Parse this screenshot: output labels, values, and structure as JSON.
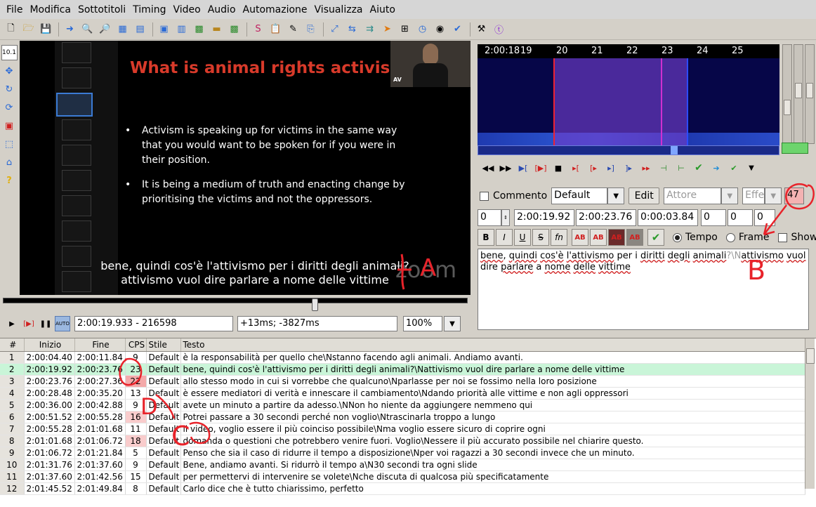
{
  "menu": [
    "File",
    "Modifica",
    "Sottotitoli",
    "Timing",
    "Video",
    "Audio",
    "Automazione",
    "Visualizza",
    "Aiuto"
  ],
  "video": {
    "slide_title": "What is animal rights activism",
    "bullet1": "Activism is speaking up for victims in the same way that you would want to be spoken for if you were in their position.",
    "bullet2": "It is being a medium of truth and enacting change by prioritising the victims and not the oppressors.",
    "subtitle_line1": "bene, quindi cos'è l'attivismo per i diritti degli animali?",
    "subtitle_line2": "attivismo vuol dire parlare a nome delle vittime",
    "cam_label": "AV",
    "watermark": "zoom",
    "time_field": "2:00:19.933 - 216598",
    "offset_field": "+13ms; -3827ms",
    "zoom_value": "100%",
    "seek_position_fraction": 0.68
  },
  "audio": {
    "ruler": [
      "2:00:18",
      "19",
      "20",
      "21",
      "22",
      "23",
      "24",
      "25"
    ]
  },
  "editor": {
    "comment_label": "Commento",
    "style_value": "Default",
    "edit_button": "Edit",
    "actor_placeholder": "Attore",
    "effect_placeholder": "Effe",
    "cps_value": "47",
    "layer": "0",
    "start": "2:00:19.92",
    "end": "2:00:23.76",
    "duration": "0:00:03.84",
    "margin_l": "0",
    "margin_r": "0",
    "margin_v": "0",
    "fmt_bold": "B",
    "fmt_italic": "I",
    "fmt_underline": "U",
    "fmt_strike": "S",
    "fmt_fn": "fn",
    "fmt_ab": "AB",
    "radio_time": "Tempo",
    "radio_frame": "Frame",
    "show_label": "Show",
    "text_words": [
      "bene",
      ", ",
      "quindi",
      " ",
      "cos'è",
      " ",
      "l'attivismo",
      " per i ",
      "diritti",
      " ",
      "degli",
      " ",
      "animali",
      "?\\N",
      "attivismo",
      " ",
      "vuol",
      " dire ",
      "parlare",
      " a ",
      "nome",
      " ",
      "delle",
      " ",
      "vittime"
    ]
  },
  "grid": {
    "headers": [
      "#",
      "Inizio",
      "Fine",
      "CPS",
      "Stile",
      "Testo"
    ],
    "rows": [
      {
        "n": "1",
        "start": "2:00:04.40",
        "end": "2:00:11.84",
        "cps": "9",
        "style": "Default",
        "text": "è la responsabilità per quello che\\Nstanno facendo agli animali. Andiamo avanti."
      },
      {
        "n": "2",
        "start": "2:00:19.92",
        "end": "2:00:23.76",
        "cps": "23",
        "style": "Default",
        "text": "bene, quindi cos'è l'attivismo per i diritti degli animali?\\Nattivismo vuol dire parlare a nome delle vittime"
      },
      {
        "n": "3",
        "start": "2:00:23.76",
        "end": "2:00:27.36",
        "cps": "22",
        "style": "Default",
        "text": "allo stesso modo in cui si vorrebbe che qualcuno\\Nparlasse per noi se fossimo nella loro posizione"
      },
      {
        "n": "4",
        "start": "2:00:28.48",
        "end": "2:00:35.20",
        "cps": "13",
        "style": "Default",
        "text": "è essere mediatori di verità e innescare il cambiamento\\Ndando priorità alle vittime e non agli oppressori"
      },
      {
        "n": "5",
        "start": "2:00:36.00",
        "end": "2:00:42.88",
        "cps": "9",
        "style": "Default",
        "text": "avete un minuto a partire da adesso.\\NNon ho niente da aggiungere nemmeno qui"
      },
      {
        "n": "6",
        "start": "2:00:51.52",
        "end": "2:00:55.28",
        "cps": "16",
        "style": "Default",
        "text": "Potrei passare a 30 secondi perché non voglio\\Ntrascinarla troppo a lungo"
      },
      {
        "n": "7",
        "start": "2:00:55.28",
        "end": "2:01:01.68",
        "cps": "11",
        "style": "Default",
        "text": "il video, voglio essere il più coinciso possibile\\Nma voglio essere sicuro di coprire ogni"
      },
      {
        "n": "8",
        "start": "2:01:01.68",
        "end": "2:01:06.72",
        "cps": "18",
        "style": "Default",
        "text": "domanda o questioni che potrebbero venire fuori. Voglio\\Nessere il più accurato possibile nel chiarire questo."
      },
      {
        "n": "9",
        "start": "2:01:06.72",
        "end": "2:01:21.84",
        "cps": "5",
        "style": "Default",
        "text": "Penso che sia il caso di ridurre il tempo a disposizione\\Nper voi ragazzi a 30 secondi invece che un minuto."
      },
      {
        "n": "10",
        "start": "2:01:31.76",
        "end": "2:01:37.60",
        "cps": "9",
        "style": "Default",
        "text": "Bene, andiamo avanti. Si ridurrò il tempo a\\N30 secondi tra ogni slide"
      },
      {
        "n": "11",
        "start": "2:01:37.60",
        "end": "2:01:42.56",
        "cps": "15",
        "style": "Default",
        "text": "per permettervi di intervenire se volete\\Nche discuta di qualcosa più specificatamente"
      },
      {
        "n": "12",
        "start": "2:01:45.52",
        "end": "2:01:49.84",
        "cps": "8",
        "style": "Default",
        "text": "Carlo dice che è tutto chiarissimo, perfetto"
      }
    ]
  },
  "annotations": {
    "a": "A",
    "b": "B",
    "c": "C",
    "d": "D"
  },
  "colors": {
    "accent_red": "#e8232a",
    "active_row": "#c9f5d8",
    "cps_warn": "#f9cccc",
    "cps_hot": "#f4a9a9"
  }
}
